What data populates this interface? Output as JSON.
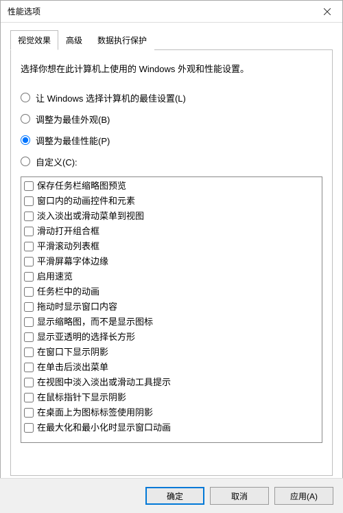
{
  "window": {
    "title": "性能选项"
  },
  "tabs": [
    {
      "label": "视觉效果",
      "active": true
    },
    {
      "label": "高级",
      "active": false
    },
    {
      "label": "数据执行保护",
      "active": false
    }
  ],
  "description": "选择你想在此计算机上使用的 Windows 外观和性能设置。",
  "radios": [
    {
      "label": "让 Windows 选择计算机的最佳设置(L)",
      "checked": false
    },
    {
      "label": "调整为最佳外观(B)",
      "checked": false
    },
    {
      "label": "调整为最佳性能(P)",
      "checked": true
    },
    {
      "label": "自定义(C):",
      "checked": false
    }
  ],
  "checkboxes": [
    {
      "label": "保存任务栏缩略图预览",
      "checked": false
    },
    {
      "label": "窗口内的动画控件和元素",
      "checked": false
    },
    {
      "label": "淡入淡出或滑动菜单到视图",
      "checked": false
    },
    {
      "label": "滑动打开组合框",
      "checked": false
    },
    {
      "label": "平滑滚动列表框",
      "checked": false
    },
    {
      "label": "平滑屏幕字体边缘",
      "checked": false
    },
    {
      "label": "启用速览",
      "checked": false
    },
    {
      "label": "任务栏中的动画",
      "checked": false
    },
    {
      "label": "拖动时显示窗口内容",
      "checked": false
    },
    {
      "label": "显示缩略图，而不是显示图标",
      "checked": false
    },
    {
      "label": "显示亚透明的选择长方形",
      "checked": false
    },
    {
      "label": "在窗口下显示阴影",
      "checked": false
    },
    {
      "label": "在单击后淡出菜单",
      "checked": false
    },
    {
      "label": "在视图中淡入淡出或滑动工具提示",
      "checked": false
    },
    {
      "label": "在鼠标指针下显示阴影",
      "checked": false
    },
    {
      "label": "在桌面上为图标标签使用阴影",
      "checked": false
    },
    {
      "label": "在最大化和最小化时显示窗口动画",
      "checked": false
    }
  ],
  "buttons": {
    "ok": "确定",
    "cancel": "取消",
    "apply": "应用(A)"
  }
}
